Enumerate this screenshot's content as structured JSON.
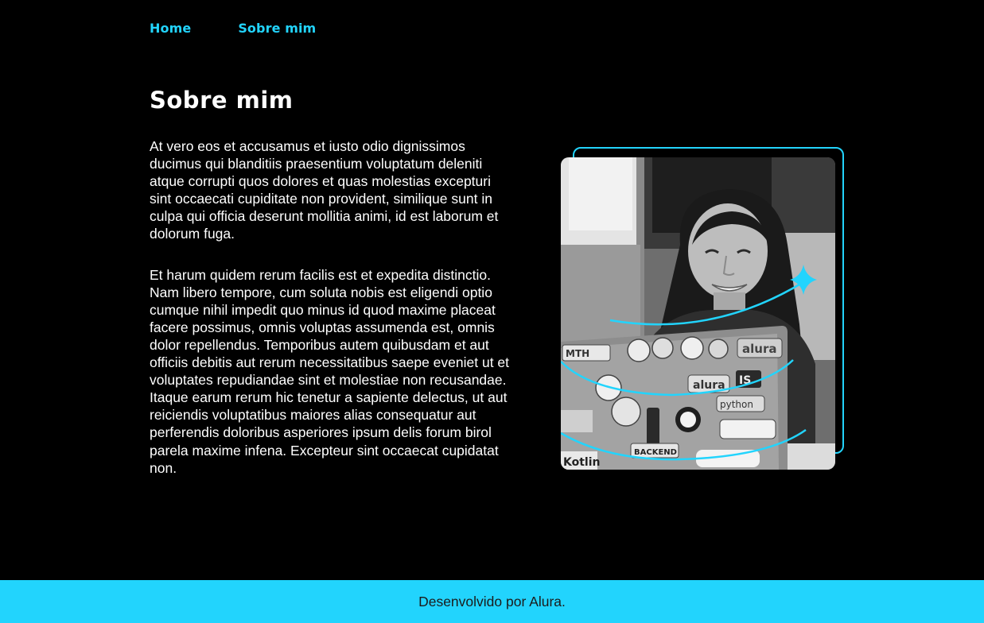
{
  "nav": {
    "items": [
      {
        "label": "Home"
      },
      {
        "label": "Sobre mim"
      }
    ]
  },
  "main": {
    "title": "Sobre mim",
    "paragraphs": [
      "At vero eos et accusamus et iusto odio dignissimos ducimus qui blanditiis praesentium voluptatum deleniti atque corrupti quos dolores et quas molestias excepturi sint occaecati cupiditate non provident, similique sunt in culpa qui officia deserunt mollitia animi, id est laborum et dolorum fuga.",
      "Et harum quidem rerum facilis est et expedita distinctio. Nam libero tempore, cum soluta nobis est eligendi optio cumque nihil impedit quo minus id quod maxime placeat facere possimus, omnis voluptas assumenda est, omnis dolor repellendus. Temporibus autem quibusdam et aut officiis debitis aut rerum necessitatibus saepe eveniet ut et voluptates repudiandae sint et molestiae non recusandae. Itaque earum rerum hic tenetur a sapiente delectus, ut aut reiciendis voluptatibus maiores alias consequatur aut perferendis doloribus asperiores ipsum delis forum birol parela maxime infena. Excepteur sint occaecat cupidatat non."
    ]
  },
  "photo": {
    "laptop_stickers": [
      "alura",
      "alura",
      "python",
      "IS",
      "BACKEND",
      "Kotlin",
      "MTH"
    ]
  },
  "footer": {
    "text": "Desenvolvido por Alura."
  },
  "colors": {
    "accent": "#22d4fd",
    "background": "#000000",
    "text": "#ffffff",
    "footer_text": "#1b1b1b"
  }
}
